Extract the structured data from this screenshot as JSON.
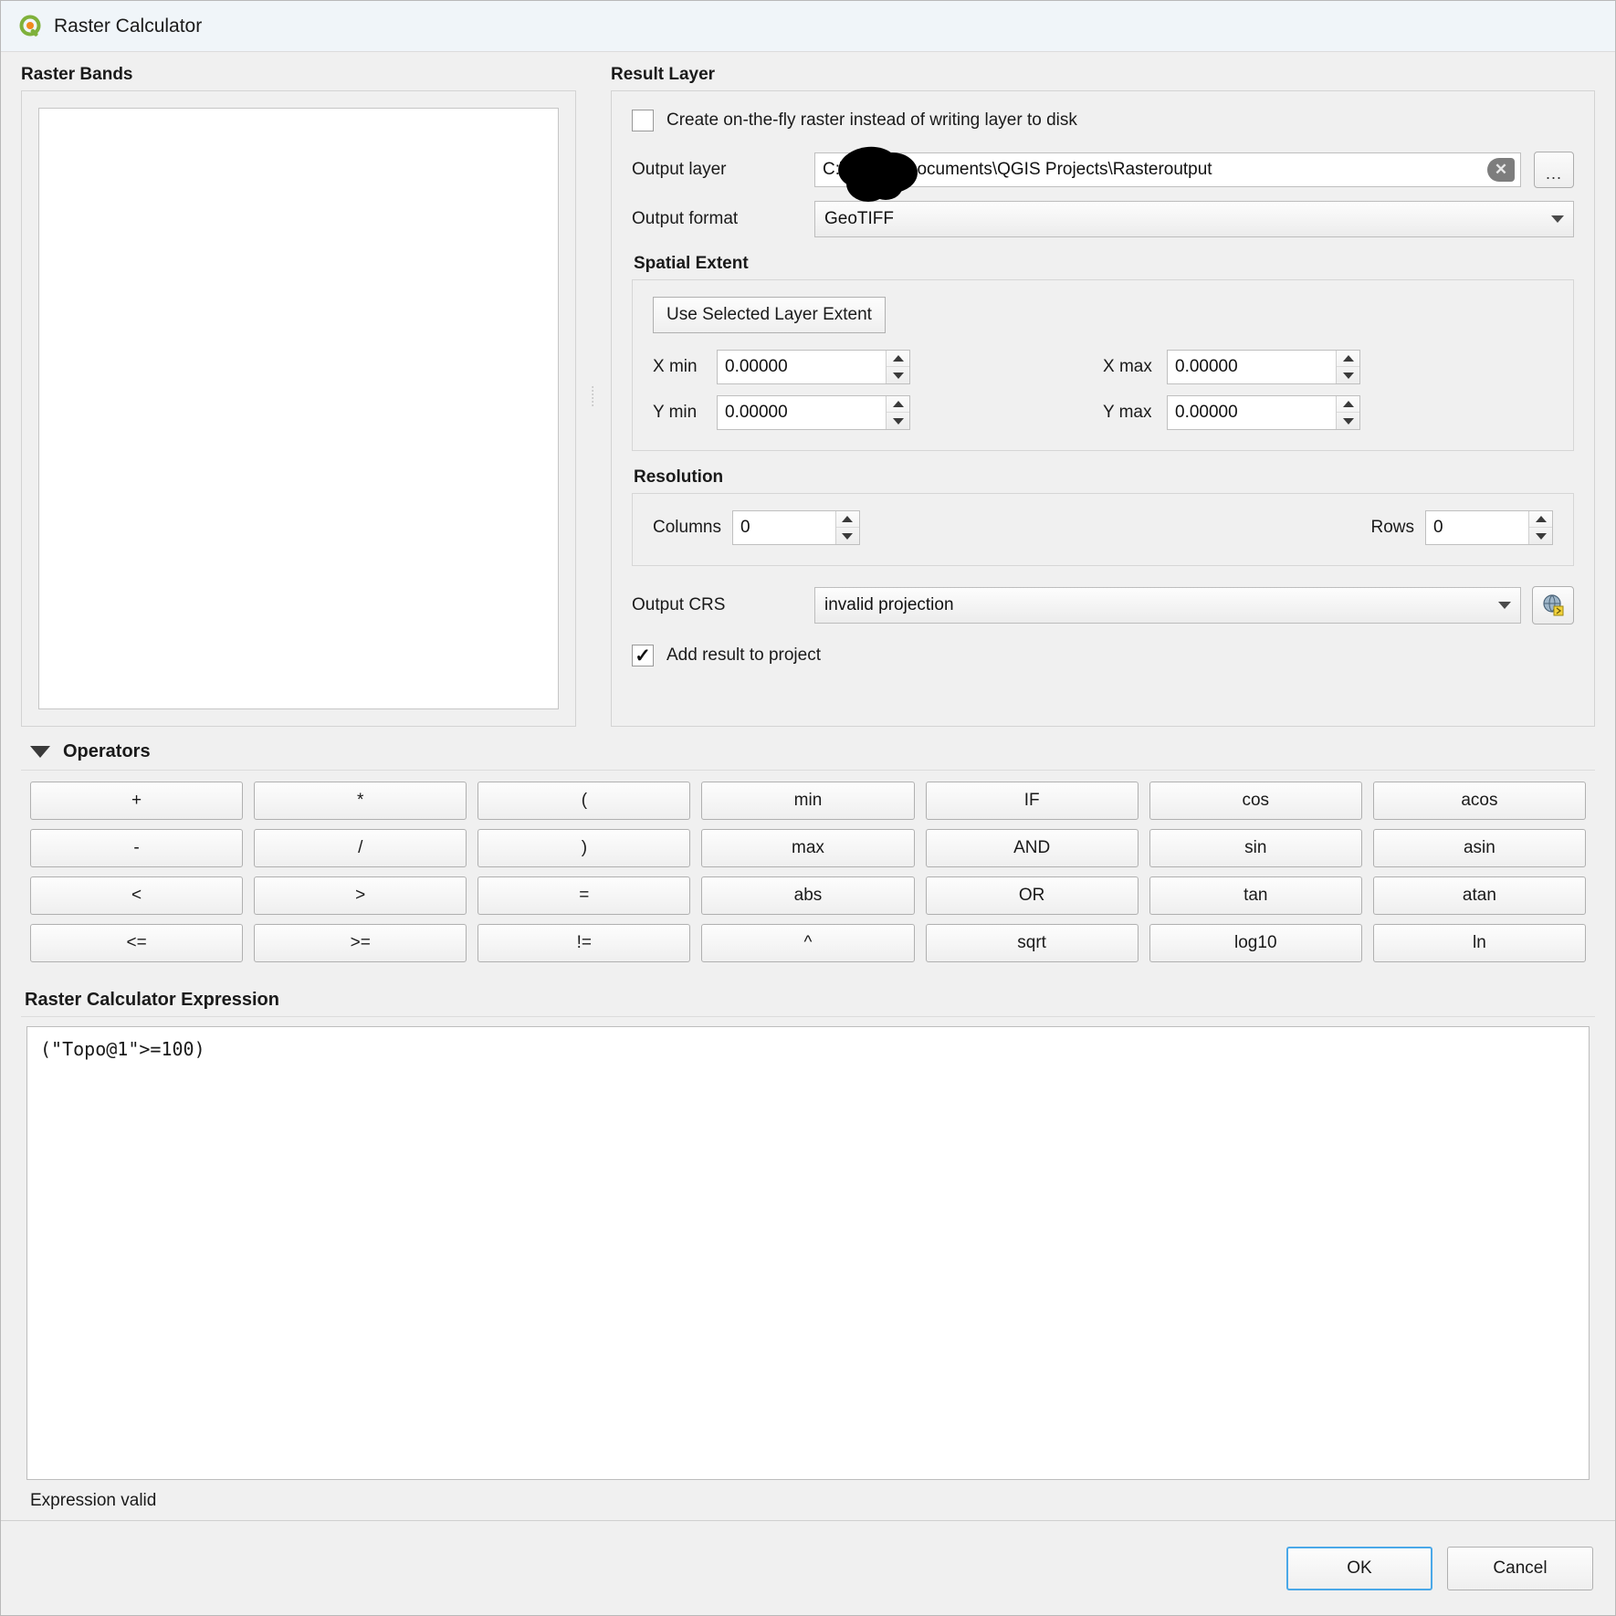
{
  "window": {
    "title": "Raster Calculator",
    "icon": "qgis-logo-icon"
  },
  "raster_bands": {
    "group_title": "Raster Bands",
    "items": []
  },
  "result_layer": {
    "group_title": "Result Layer",
    "on_the_fly": {
      "label": "Create on-the-fly raster instead of writing layer to disk",
      "checked": false
    },
    "output_layer": {
      "label": "Output layer",
      "value": "C:\\Users\\          \\Documents\\QGIS Projects\\Rasteroutput",
      "clear_icon": "clear-x-icon",
      "browse_label": "..."
    },
    "output_format": {
      "label": "Output format",
      "value": "GeoTIFF"
    },
    "spatial_extent": {
      "title": "Spatial Extent",
      "use_extent_button": "Use Selected Layer Extent",
      "fields": [
        {
          "label": "X min",
          "value": "0.00000"
        },
        {
          "label": "X max",
          "value": "0.00000"
        },
        {
          "label": "Y min",
          "value": "0.00000"
        },
        {
          "label": "Y max",
          "value": "0.00000"
        }
      ]
    },
    "resolution": {
      "title": "Resolution",
      "columns_label": "Columns",
      "columns_value": "0",
      "rows_label": "Rows",
      "rows_value": "0"
    },
    "output_crs": {
      "label": "Output CRS",
      "value": "invalid projection",
      "select_icon": "crs-globe-icon"
    },
    "add_result": {
      "label": "Add result to project",
      "checked": true
    }
  },
  "operators": {
    "title": "Operators",
    "buttons": [
      "+",
      "*",
      "(",
      "min",
      "IF",
      "cos",
      "acos",
      "-",
      "/",
      ")",
      "max",
      "AND",
      "sin",
      "asin",
      "<",
      ">",
      "=",
      "abs",
      "OR",
      "tan",
      "atan",
      "<=",
      ">=",
      "!=",
      "^",
      "sqrt",
      "log10",
      "ln"
    ]
  },
  "expression": {
    "title": "Raster Calculator Expression",
    "value": "(\"Topo@1\">=100)",
    "status": "Expression valid"
  },
  "footer": {
    "ok_label": "OK",
    "cancel_label": "Cancel"
  },
  "colors": {
    "titlebar_bg": "#f0f5f9",
    "dialog_bg": "#f0f0f0",
    "accent_focus": "#4aa8e8",
    "logo_green": "#7fb13b"
  }
}
